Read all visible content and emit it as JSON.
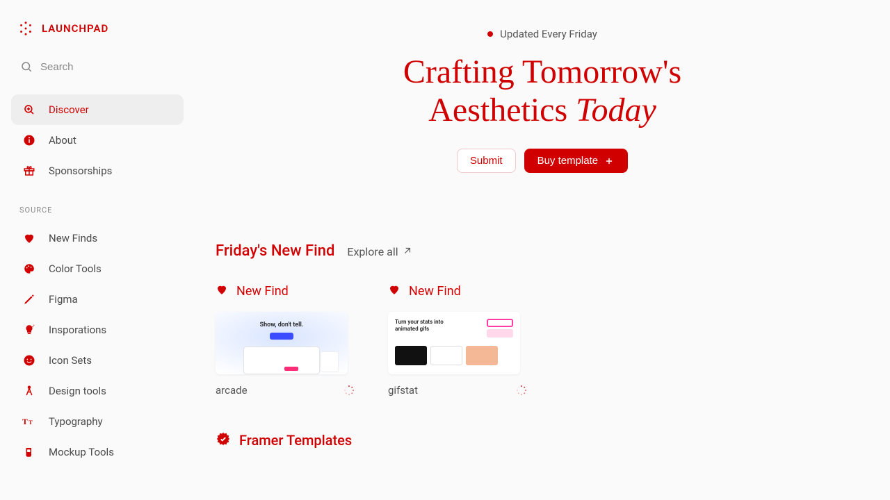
{
  "brand": {
    "name": "LAUNCHPAD"
  },
  "search": {
    "placeholder": "Search"
  },
  "nav": {
    "primary": [
      {
        "label": "Discover",
        "icon": "magnifier-plus",
        "active": true
      },
      {
        "label": "About",
        "icon": "info"
      },
      {
        "label": "Sponsorships",
        "icon": "gift"
      }
    ],
    "source_heading": "SOURCE",
    "source": [
      {
        "label": "New Finds",
        "icon": "heart"
      },
      {
        "label": "Color Tools",
        "icon": "palette"
      },
      {
        "label": "Figma",
        "icon": "pen"
      },
      {
        "label": "Insporations",
        "icon": "bulb"
      },
      {
        "label": "Icon Sets",
        "icon": "smile"
      },
      {
        "label": "Design tools",
        "icon": "compass"
      },
      {
        "label": "Typography",
        "icon": "type"
      },
      {
        "label": "Mockup Tools",
        "icon": "cup"
      }
    ]
  },
  "hero": {
    "update_label": "Updated Every Friday",
    "title_line1": "Crafting Tomorrow's",
    "title_line2a": "Aesthetics ",
    "title_line2b": "Today",
    "submit_label": "Submit",
    "buy_label": "Buy template"
  },
  "section_new": {
    "title": "Friday's New Find",
    "explore": "Explore all",
    "badge": "New Find",
    "cards": [
      {
        "name": "arcade",
        "thumb_caption": "Show, don't tell."
      },
      {
        "name": "gifstat",
        "thumb_caption": "Turn your stats into animated gifs"
      }
    ]
  },
  "section_framer": {
    "title": "Framer Templates"
  },
  "colors": {
    "accent": "#d10000"
  }
}
